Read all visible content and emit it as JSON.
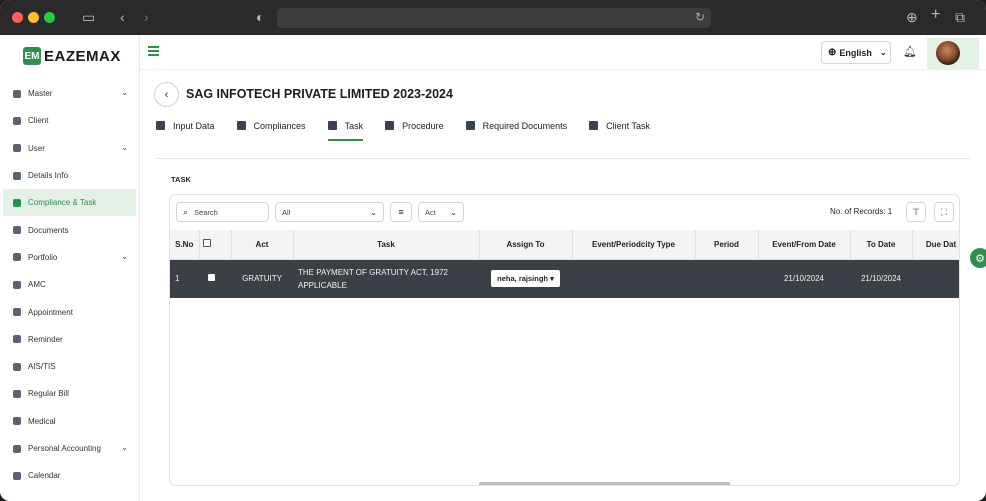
{
  "brand": {
    "name": "EAZEMAX",
    "mark": "EM"
  },
  "sidebar": {
    "items": [
      {
        "label": "Master",
        "icon": "folder-icon",
        "caret": true
      },
      {
        "label": "Client",
        "icon": "client-icon",
        "caret": false
      },
      {
        "label": "User",
        "icon": "briefcase-icon",
        "caret": true
      },
      {
        "label": "Details Info",
        "icon": "document-icon",
        "caret": false
      },
      {
        "label": "Compliance & Task",
        "icon": "handshake-icon",
        "caret": false,
        "active": true
      },
      {
        "label": "Documents",
        "icon": "documents-icon",
        "caret": false
      },
      {
        "label": "Portfolio",
        "icon": "portfolio-icon",
        "caret": true
      },
      {
        "label": "AMC",
        "icon": "amc-icon",
        "caret": false
      },
      {
        "label": "Appointment",
        "icon": "appointment-icon",
        "caret": false
      },
      {
        "label": "Reminder",
        "icon": "reminder-icon",
        "caret": false
      },
      {
        "label": "AIS/TIS",
        "icon": "tag-icon",
        "caret": false
      },
      {
        "label": "Regular Bill",
        "icon": "user-bill-icon",
        "caret": false
      },
      {
        "label": "Medical",
        "icon": "medical-icon",
        "caret": false
      },
      {
        "label": "Personal Accounting",
        "icon": "accounting-icon",
        "caret": true
      },
      {
        "label": "Calendar",
        "icon": "calendar-icon",
        "caret": false
      }
    ]
  },
  "header": {
    "language": "English"
  },
  "page": {
    "title": "SAG INFOTECH PRIVATE LIMITED 2023-2024",
    "tabs": [
      {
        "label": "Input Data",
        "icon": "input-data-icon"
      },
      {
        "label": "Compliances",
        "icon": "compliances-icon"
      },
      {
        "label": "Task",
        "icon": "task-icon",
        "active": true
      },
      {
        "label": "Procedure",
        "icon": "procedure-icon"
      },
      {
        "label": "Required Documents",
        "icon": "required-documents-icon"
      },
      {
        "label": "Client Task",
        "icon": "client-task-icon"
      }
    ],
    "panel_title": "TASK",
    "toolbar": {
      "search_placeholder": "Search",
      "filter_value": "All",
      "act_value": "Act",
      "records_label": "No. of Records: 1"
    },
    "table": {
      "columns": [
        "S.No",
        "",
        "Act",
        "Task",
        "Assign To",
        "Event/Periodcity Type",
        "Period",
        "Event/From Date",
        "To Date",
        "Due Dat"
      ],
      "rows": [
        {
          "sno": "1",
          "act": "GRATUITY",
          "task": "THE PAYMENT OF GRATUITY ACT, 1972 APPLICABLE",
          "assign_to": "neha, rajsingh",
          "event_type": "",
          "period": "",
          "from_date": "21/10/2024",
          "to_date": "21/10/2024",
          "due_date": ""
        }
      ]
    }
  },
  "colors": {
    "accent": "#2f8f4e",
    "active_bg": "#e3f1e6",
    "row_bg": "#3a4046"
  }
}
